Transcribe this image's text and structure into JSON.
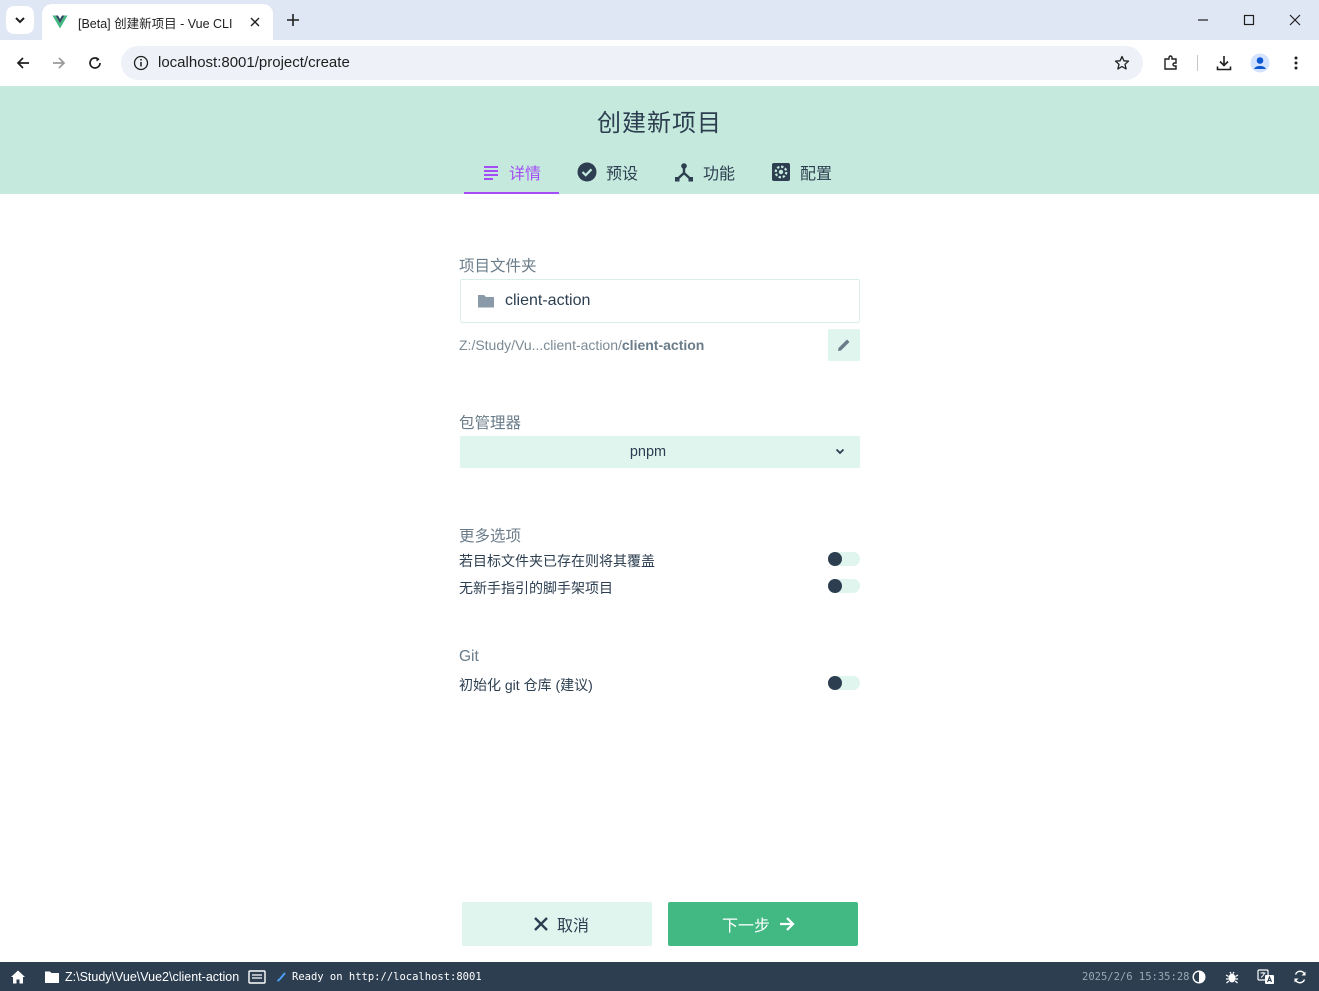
{
  "browser": {
    "tab_title": "[Beta] 创建新项目 - Vue CLI",
    "url": "localhost:8001/project/create"
  },
  "header": {
    "title": "创建新项目",
    "steps": [
      {
        "label": "详情",
        "icon": "subject-icon",
        "active": true
      },
      {
        "label": "预设",
        "icon": "check-circle-icon",
        "active": false
      },
      {
        "label": "功能",
        "icon": "device-hub-icon",
        "active": false
      },
      {
        "label": "配置",
        "icon": "settings-applications-icon",
        "active": false
      }
    ]
  },
  "form": {
    "folder_label": "项目文件夹",
    "folder_value": "client-action",
    "path_prefix": "Z:/Study/Vu...client-action/",
    "path_name": "client-action",
    "package_manager_label": "包管理器",
    "package_manager_value": "pnpm",
    "more_options_label": "更多选项",
    "options": [
      {
        "label": "若目标文件夹已存在则将其覆盖",
        "enabled": false
      },
      {
        "label": "无新手指引的脚手架项目",
        "enabled": false
      }
    ],
    "git_label": "Git",
    "git_option": {
      "label": "初始化 git 仓库 (建议)",
      "enabled": false
    }
  },
  "actions": {
    "cancel": "取消",
    "next": "下一步"
  },
  "statusbar": {
    "cwd": "Z:\\Study\\Vue\\Vue2\\client-action",
    "log": "Ready on http://localhost:8001",
    "time": "2025/2/6 15:35:28"
  },
  "colors": {
    "accent": "#42b983",
    "header_bg": "#c5eadd",
    "active_step": "#a44cf6",
    "dark": "#2c3e50"
  }
}
